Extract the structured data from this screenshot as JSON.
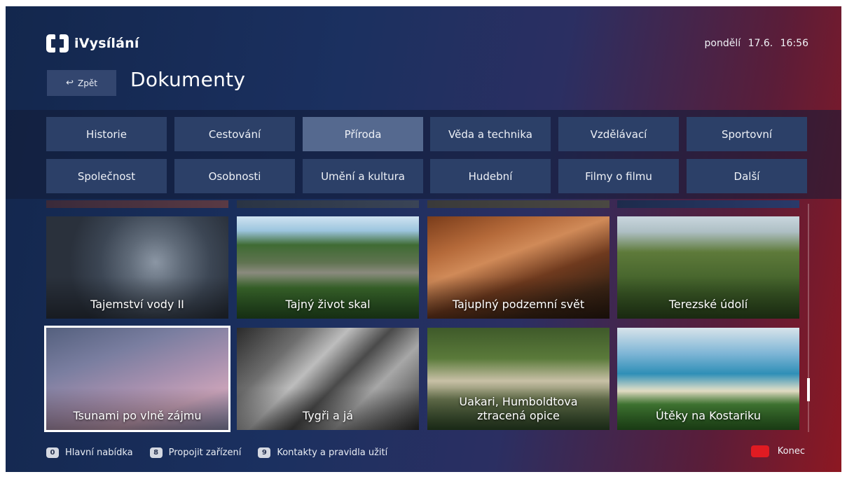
{
  "brand": {
    "name": "iVysílání"
  },
  "header": {
    "back_label": "Zpět",
    "back_glyph": "↩",
    "title": "Dokumenty",
    "datetime": "pondělí 17.6. 16:56"
  },
  "categories": [
    {
      "label": "Historie",
      "active": false
    },
    {
      "label": "Cestování",
      "active": false
    },
    {
      "label": "Příroda",
      "active": true
    },
    {
      "label": "Věda a technika",
      "active": false
    },
    {
      "label": "Vzdělávací",
      "active": false
    },
    {
      "label": "Sportovní",
      "active": false
    },
    {
      "label": "Společnost",
      "active": false
    },
    {
      "label": "Osobnosti",
      "active": false
    },
    {
      "label": "Umění a kultura",
      "active": false
    },
    {
      "label": "Hudební",
      "active": false
    },
    {
      "label": "Filmy o filmu",
      "active": false
    },
    {
      "label": "Další",
      "active": false
    }
  ],
  "programs": [
    {
      "title": "Tajemství vody II",
      "selected": false
    },
    {
      "title": "Tajný život skal",
      "selected": false
    },
    {
      "title": "Tajuplný podzemní svět",
      "selected": false
    },
    {
      "title": "Terezské údolí",
      "selected": false
    },
    {
      "title": "Tsunami po vlně zájmu",
      "selected": true
    },
    {
      "title": "Tygři a já",
      "selected": false
    },
    {
      "title": "Uakari, Humboldtova ztracená opice",
      "selected": false
    },
    {
      "title": "Útěky na Kostariku",
      "selected": false
    }
  ],
  "footer": {
    "items": [
      {
        "key": "0",
        "label": "Hlavní nabídka"
      },
      {
        "key": "8",
        "label": "Propojit zařízení"
      },
      {
        "key": "9",
        "label": "Kontakty a pravidla užití"
      }
    ],
    "exit_label": "Konec"
  },
  "scroll": {
    "position_fraction": 0.85
  },
  "colors": {
    "accent_red": "#e01b22",
    "active_category": "#55698f",
    "category": "#2c4068"
  }
}
